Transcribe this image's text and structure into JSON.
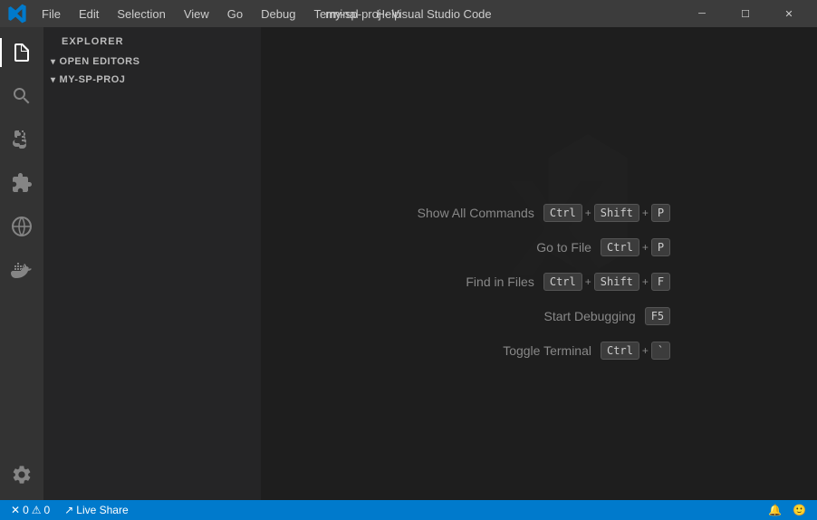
{
  "titlebar": {
    "title": "my-sp-proj - Visual Studio Code",
    "menu_items": [
      "File",
      "Edit",
      "Selection",
      "View",
      "Go",
      "Debug",
      "Terminal",
      "Help"
    ],
    "min_label": "─",
    "max_label": "☐",
    "close_label": "✕"
  },
  "activity_bar": {
    "icons": [
      {
        "name": "explorer-icon",
        "label": "Explorer",
        "active": true
      },
      {
        "name": "search-icon",
        "label": "Search",
        "active": false
      },
      {
        "name": "source-control-icon",
        "label": "Source Control",
        "active": false
      },
      {
        "name": "extensions-icon",
        "label": "Extensions",
        "active": false
      },
      {
        "name": "remote-explorer-icon",
        "label": "Remote Explorer",
        "active": false
      },
      {
        "name": "docker-icon",
        "label": "Docker",
        "active": false
      }
    ],
    "bottom_icon": {
      "name": "settings-icon",
      "label": "Settings"
    }
  },
  "sidebar": {
    "header": "Explorer",
    "sections": [
      {
        "name": "open-editors",
        "label": "Open Editors",
        "expanded": true,
        "items": []
      },
      {
        "name": "my-sp-proj",
        "label": "MY-SP-PROJ",
        "expanded": true,
        "items": []
      }
    ]
  },
  "editor": {
    "shortcuts": [
      {
        "label": "Show All Commands",
        "keys": [
          "Ctrl",
          "+",
          "Shift",
          "+",
          "P"
        ]
      },
      {
        "label": "Go to File",
        "keys": [
          "Ctrl",
          "+",
          "P"
        ]
      },
      {
        "label": "Find in Files",
        "keys": [
          "Ctrl",
          "+",
          "Shift",
          "+",
          "F"
        ]
      },
      {
        "label": "Start Debugging",
        "keys": [
          "F5"
        ]
      },
      {
        "label": "Toggle Terminal",
        "keys": [
          "Ctrl",
          "+",
          "`"
        ]
      }
    ]
  },
  "statusbar": {
    "errors": "0",
    "warnings": "0",
    "liveshare_label": "Live Share",
    "error_icon": "✕",
    "warning_icon": "⚠"
  }
}
